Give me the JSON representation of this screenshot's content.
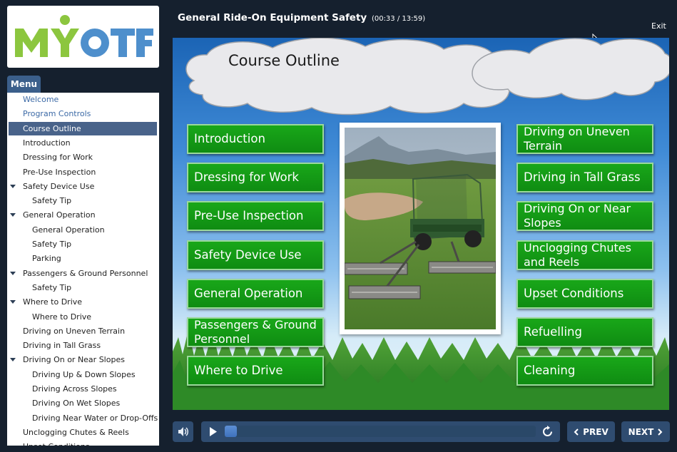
{
  "logo": {
    "text": "MYOTF",
    "colors": {
      "green": "#8cc63f",
      "blue": "#4e8fcc"
    }
  },
  "menu": {
    "tab_label": "Menu",
    "items": [
      {
        "label": "Welcome",
        "level": 0,
        "state": "link"
      },
      {
        "label": "Program Controls",
        "level": 0,
        "state": "link"
      },
      {
        "label": "Course Outline",
        "level": 0,
        "state": "active"
      },
      {
        "label": "Introduction",
        "level": 0
      },
      {
        "label": "Dressing for Work",
        "level": 0
      },
      {
        "label": "Pre-Use Inspection",
        "level": 0
      },
      {
        "label": "Safety Device Use",
        "level": 0,
        "expanded": true
      },
      {
        "label": "Safety Tip",
        "level": 1
      },
      {
        "label": "General Operation",
        "level": 0,
        "expanded": true
      },
      {
        "label": "General Operation",
        "level": 1
      },
      {
        "label": "Safety Tip",
        "level": 1
      },
      {
        "label": "Parking",
        "level": 1
      },
      {
        "label": "Passengers & Ground Personnel",
        "level": 0,
        "expanded": true
      },
      {
        "label": "Safety Tip",
        "level": 1
      },
      {
        "label": "Where to Drive",
        "level": 0,
        "expanded": true
      },
      {
        "label": "Where to Drive",
        "level": 1
      },
      {
        "label": "Driving on Uneven Terrain",
        "level": 0
      },
      {
        "label": "Driving in Tall Grass",
        "level": 0
      },
      {
        "label": "Driving On or Near Slopes",
        "level": 0,
        "expanded": true
      },
      {
        "label": "Driving Up & Down Slopes",
        "level": 1
      },
      {
        "label": "Driving Across Slopes",
        "level": 1
      },
      {
        "label": "Driving On Wet Slopes",
        "level": 1
      },
      {
        "label": "Driving Near Water or Drop-Offs",
        "level": 1
      },
      {
        "label": "Unclogging Chutes & Reels",
        "level": 0
      },
      {
        "label": "Upset Conditions",
        "level": 0
      }
    ]
  },
  "header": {
    "title": "General Ride-On Equipment Safety",
    "time": "(00:33 / 13:59)",
    "exit_label": "Exit"
  },
  "slide": {
    "title": "Course Outline",
    "left_topics": [
      "Introduction",
      "Dressing for Work",
      "Pre-Use Inspection",
      "Safety Device Use",
      "General Operation",
      "Passengers & Ground Personnel",
      "Where to Drive"
    ],
    "right_topics": [
      "Driving on Uneven Terrain",
      "Driving in Tall Grass",
      "Driving On or Near Slopes",
      "Unclogging Chutes and Reels",
      "Upset Conditions",
      "Refuelling",
      "Cleaning"
    ],
    "button_color": "#13991a"
  },
  "player": {
    "progress_fraction": 0.04,
    "prev_label": "PREV",
    "next_label": "NEXT",
    "icons": [
      "speaker-icon",
      "play-icon",
      "replay-icon",
      "chevron-left-icon",
      "chevron-right-icon"
    ]
  }
}
